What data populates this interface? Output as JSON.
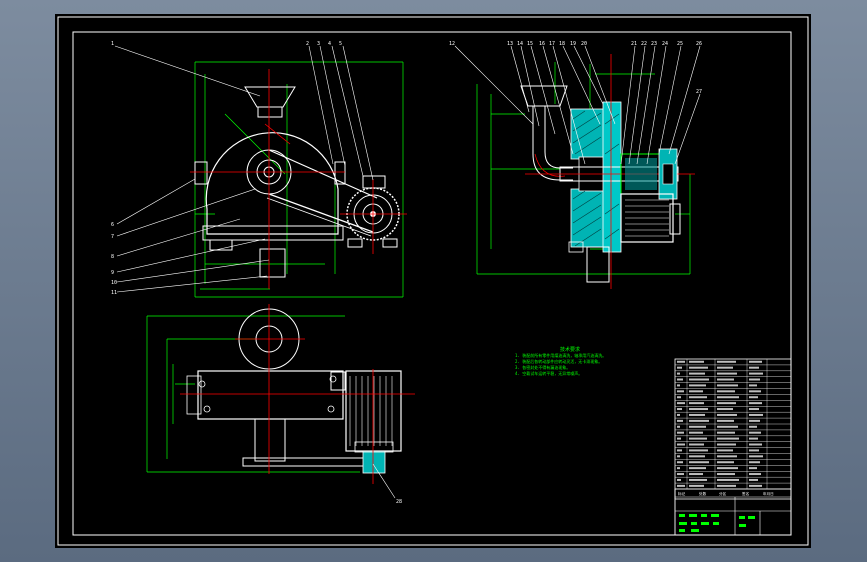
{
  "drawing": {
    "background": "#000000",
    "viewport_color": "#6b7a8e",
    "line_colors": {
      "outline": "#ffffff",
      "dimension": "#00ff00",
      "center": "#ff0000",
      "section": "#00ffff",
      "leader": "#ffffff"
    },
    "front_view": {
      "part_labels": [
        "1",
        "2",
        "3",
        "4",
        "5",
        "6",
        "7",
        "8",
        "9",
        "10",
        "11"
      ]
    },
    "side_view": {
      "part_labels": [
        "12",
        "13",
        "14",
        "15",
        "16",
        "17",
        "18",
        "19",
        "20",
        "21",
        "22",
        "23",
        "24",
        "25",
        "26",
        "27"
      ]
    },
    "top_view": {
      "part_labels": [
        "28"
      ]
    },
    "technical_notes": {
      "title": "技术要求",
      "lines": [
        "1. 装配前所有零件用煤油清洗，轴承用汽油清洗。",
        "2. 装配后各转动部件应转动灵活，无卡滞现象。",
        "3. 各密封处不得有漏油现象。",
        "4. 空载试车运转平稳，无异常噪声。"
      ]
    },
    "title_block": {
      "bottom_labels": [
        "标记",
        "处数",
        "分区",
        "签名",
        "年月日"
      ]
    }
  }
}
